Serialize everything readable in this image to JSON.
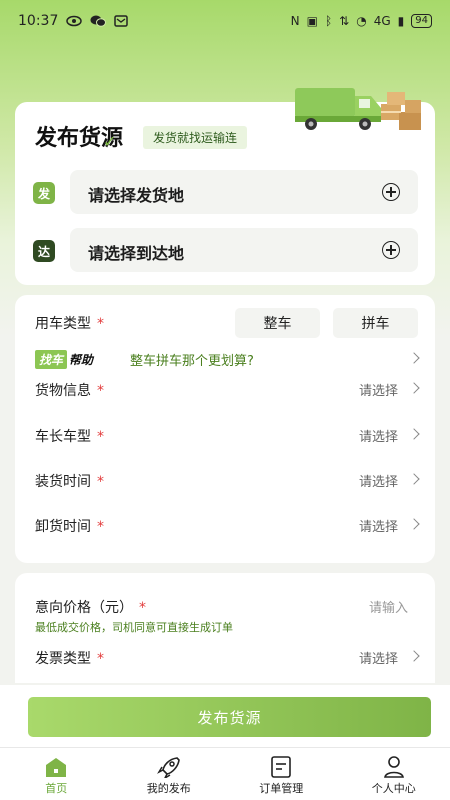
{
  "status": {
    "time": "10:37",
    "network": "4G",
    "battery": "94"
  },
  "header": {
    "title": "发布货源",
    "subtitle": "发货就找运输连"
  },
  "address": {
    "from_tag": "发",
    "from_placeholder": "请选择发货地",
    "to_tag": "达",
    "to_placeholder": "请选择到达地"
  },
  "form": {
    "vehicle_type_label": "用车类型",
    "options": [
      "整车",
      "拼车"
    ],
    "help_badge_a": "找车",
    "help_badge_b": "帮助",
    "help_text": "整车拼车那个更划算?",
    "rows": [
      {
        "label": "货物信息",
        "value": "请选择"
      },
      {
        "label": "车长车型",
        "value": "请选择"
      },
      {
        "label": "装货时间",
        "value": "请选择"
      },
      {
        "label": "卸货时间",
        "value": "请选择"
      }
    ],
    "required_mark": "*"
  },
  "price": {
    "label": "意向价格（元）",
    "placeholder": "请输入",
    "hint": "最低成交价格，司机同意可直接生成订单",
    "invoice_label": "发票类型",
    "invoice_value": "请选择"
  },
  "publish_label": "发布货源",
  "tabs": [
    {
      "label": "首页",
      "icon": "home-icon",
      "active": true
    },
    {
      "label": "我的发布",
      "icon": "rocket-icon",
      "active": false
    },
    {
      "label": "订单管理",
      "icon": "document-icon",
      "active": false
    },
    {
      "label": "个人中心",
      "icon": "person-icon",
      "active": false
    }
  ],
  "colors": {
    "accent": "#8cc653",
    "tag_from": "#7fb447",
    "tag_to": "#2f4a22",
    "required": "#e23c3c"
  }
}
